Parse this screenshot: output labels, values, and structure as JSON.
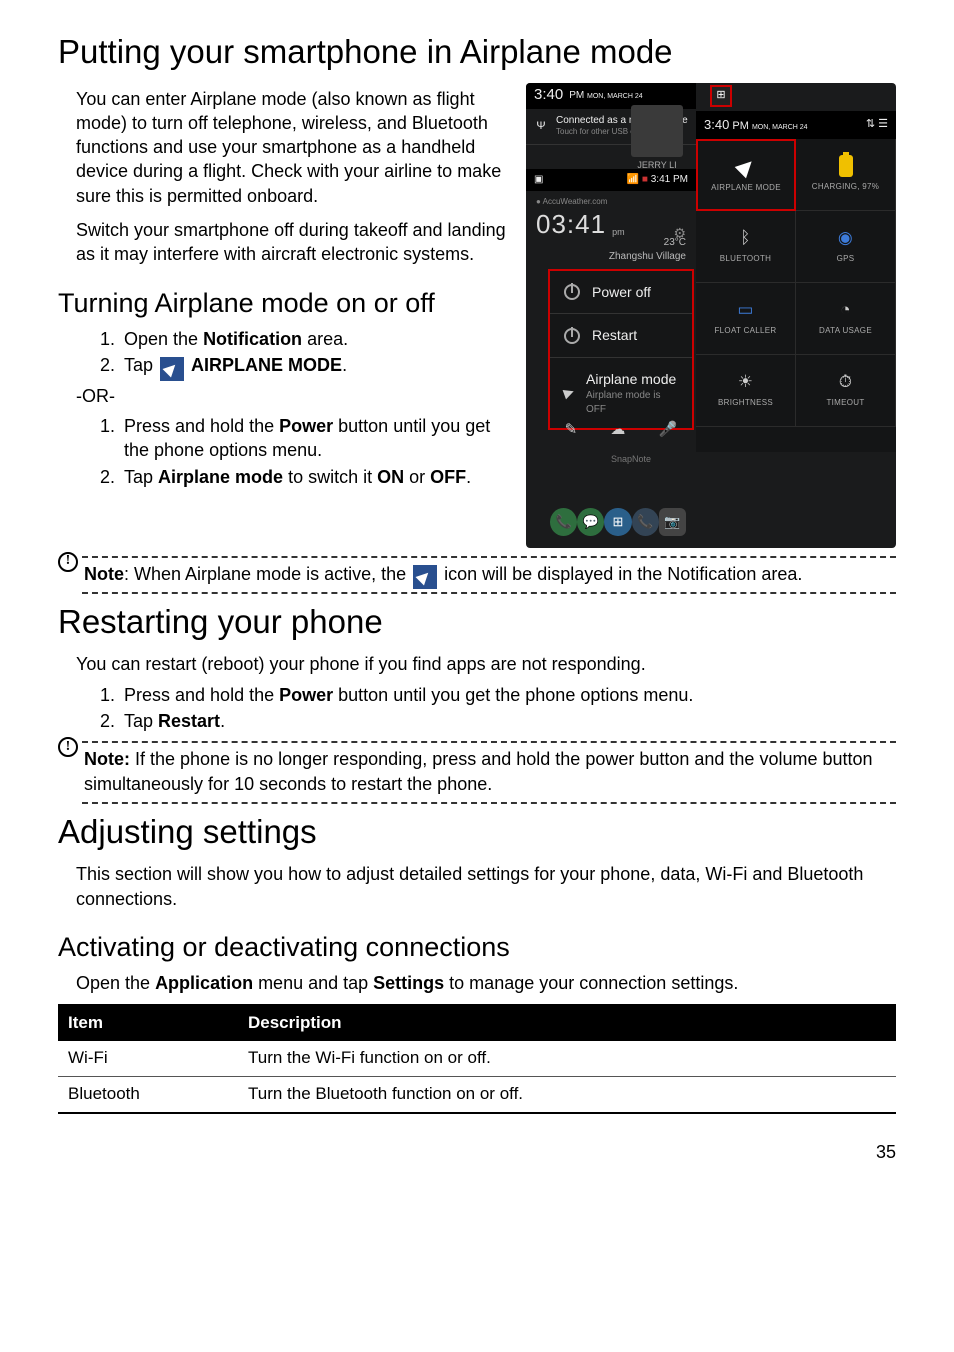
{
  "h1_airplane": "Putting your smartphone in Airplane mode",
  "p_airplane1": "You can enter Airplane mode (also known as flight mode) to turn off telephone, wireless, and Bluetooth functions and use your smartphone as a handheld device during a flight. Check with your airline to make sure this is permitted onboard.",
  "p_airplane2": "Switch your smartphone off during takeoff and landing as it may interfere with aircraft electronic systems.",
  "h2_turning": "Turning Airplane mode on or off",
  "steps1": {
    "s1a": "Open the ",
    "s1b": "Notification",
    "s1c": " area.",
    "s2a": "Tap ",
    "s2b": "AIRPLANE MODE",
    "s2c": "."
  },
  "or_label": "-OR-",
  "steps_or": {
    "s1a": "Press and hold the ",
    "s1b": "Power",
    "s1c": " button until you get the phone options menu.",
    "s2a": "Tap ",
    "s2b": "Airplane mode",
    "s2c": " to switch it ",
    "s2d": "ON",
    "s2e": " or ",
    "s2f": "OFF",
    "s2g": "."
  },
  "note1": {
    "prefix": "Note",
    "a": ": When Airplane mode is active, the ",
    "b": " icon will be displayed in the Notification area."
  },
  "h1_restart": "Restarting your phone",
  "p_restart": "You can restart (reboot) your phone if you find apps are not responding.",
  "restart_steps": {
    "s1a": "Press and hold the ",
    "s1b": "Power",
    "s1c": " button until you get the phone options menu.",
    "s2a": "Tap ",
    "s2b": "Restart",
    "s2c": "."
  },
  "note2": {
    "prefix": "Note:",
    "text": " If the phone is no longer responding, press and hold the power button and the volume button simultaneously for 10 seconds to restart the phone."
  },
  "h1_adjust": "Adjusting settings",
  "p_adjust": "This section will show you how to adjust detailed settings for your phone, data, Wi-Fi and Bluetooth connections.",
  "h2_activating": "Activating or deactivating connections",
  "p_activating": {
    "a": "Open the ",
    "b": "Application",
    "c": " menu and tap ",
    "d": "Settings",
    "e": " to manage your connection settings."
  },
  "table": {
    "h1": "Item",
    "h2": "Description",
    "rows": [
      {
        "item": "Wi-Fi",
        "desc": "Turn the Wi-Fi function on or off."
      },
      {
        "item": "Bluetooth",
        "desc": "Turn the Bluetooth function on or off."
      }
    ]
  },
  "page_number": "35",
  "screenshot": {
    "time1": "3:40",
    "time1_suffix": "PM",
    "date_small": "MON, MARCH 24",
    "media_title": "Connected as a media device",
    "media_sub": "Touch for other USB opt",
    "time2": "3:40",
    "status2_left": "",
    "status2_right": "3:41 PM",
    "accu_site": "AccuWeather.com",
    "accu_time": "03:41",
    "accu_pm": "pm",
    "accu_loc": "Zhangshu Village",
    "accu_temp": "23°C",
    "jerry": "JERRY LI",
    "opts": {
      "power_off": "Power off",
      "restart": "Restart",
      "airplane": "Airplane mode",
      "airplane_sub": "Airplane mode is OFF"
    },
    "snapnote": "SnapNote",
    "toggles": {
      "airplane": "AIRPLANE MODE",
      "charging": "CHARGING, 97%",
      "bluetooth": "BLUETOOTH",
      "gps": "GPS",
      "float": "FLOAT CALLER",
      "data": "DATA USAGE",
      "brightness": "BRIGHTNESS",
      "timeout": "TIMEOUT"
    }
  }
}
